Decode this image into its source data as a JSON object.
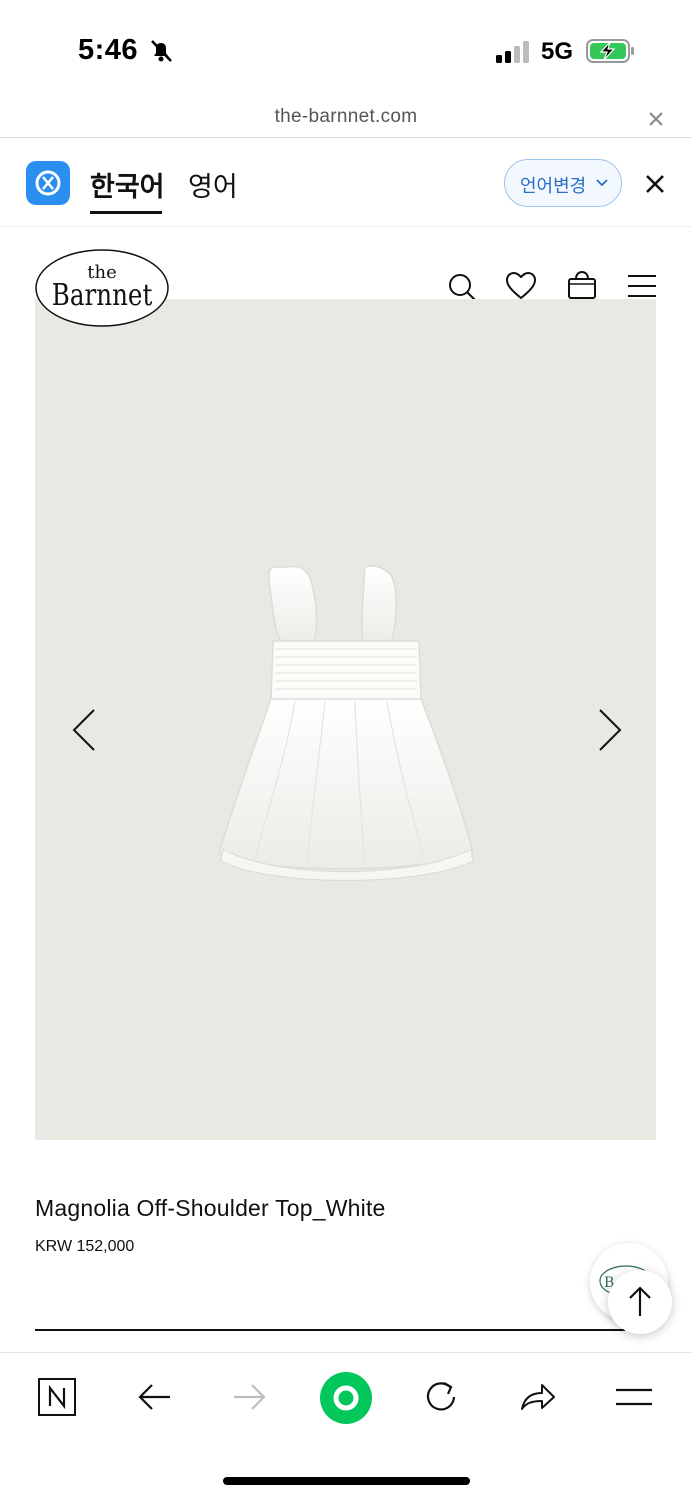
{
  "status_bar": {
    "time": "5:46",
    "network": "5G",
    "icons": [
      "bell-slash-icon",
      "signal-icon",
      "battery-charging-icon"
    ]
  },
  "browser": {
    "url": "the-barnnet.com"
  },
  "translate_bar": {
    "tabs": [
      {
        "label": "한국어",
        "active": true
      },
      {
        "label": "영어",
        "active": false
      }
    ],
    "change_language_label": "언어변경"
  },
  "site_header": {
    "logo_text": [
      "the",
      "Barnnet"
    ],
    "icons": [
      "search-icon",
      "heart-icon",
      "shopping-bag-icon",
      "menu-icon"
    ]
  },
  "product": {
    "name": "Magnolia Off-Shoulder Top_White",
    "price": "KRW 152,000"
  },
  "toolbar": {
    "icons": [
      "naver-n-icon",
      "back-arrow-icon",
      "forward-arrow-icon",
      "home-circle-icon",
      "reload-icon",
      "share-icon",
      "menu-icon"
    ]
  },
  "colors": {
    "accent_translate": "#2a8ff0",
    "naver_green": "#03c75a",
    "image_background": "#e9e8e3"
  }
}
